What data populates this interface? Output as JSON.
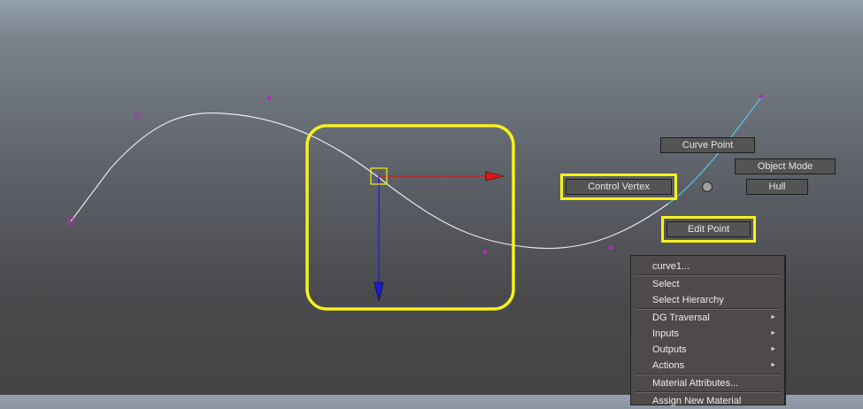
{
  "marking_menu": {
    "curve_point": "Curve Point",
    "object_mode": "Object Mode",
    "control_vertex": "Control Vertex",
    "hull": "Hull",
    "edit_point": "Edit Point"
  },
  "context_menu": {
    "title": "curve1...",
    "items": [
      {
        "label": "Select",
        "submenu": false
      },
      {
        "label": "Select Hierarchy",
        "submenu": false
      },
      {
        "label": "DG Traversal",
        "submenu": true
      },
      {
        "label": "Inputs",
        "submenu": true
      },
      {
        "label": "Outputs",
        "submenu": true
      },
      {
        "label": "Actions",
        "submenu": true
      },
      {
        "label": "Material Attributes...",
        "submenu": false
      },
      {
        "label": "Assign New Material",
        "submenu": false
      }
    ],
    "arrow_glyph": "►"
  },
  "colors": {
    "highlight": "#f6f21a",
    "curve": "#e8e8e8",
    "curve_selected": "#58c8e8",
    "vertex": "#c81ec8",
    "axis_x": "#e01818",
    "axis_y": "#1c1cd8"
  },
  "icons": {
    "submenu_arrow": "triangle-right-icon",
    "manipulator": "move-manipulator-icon"
  }
}
